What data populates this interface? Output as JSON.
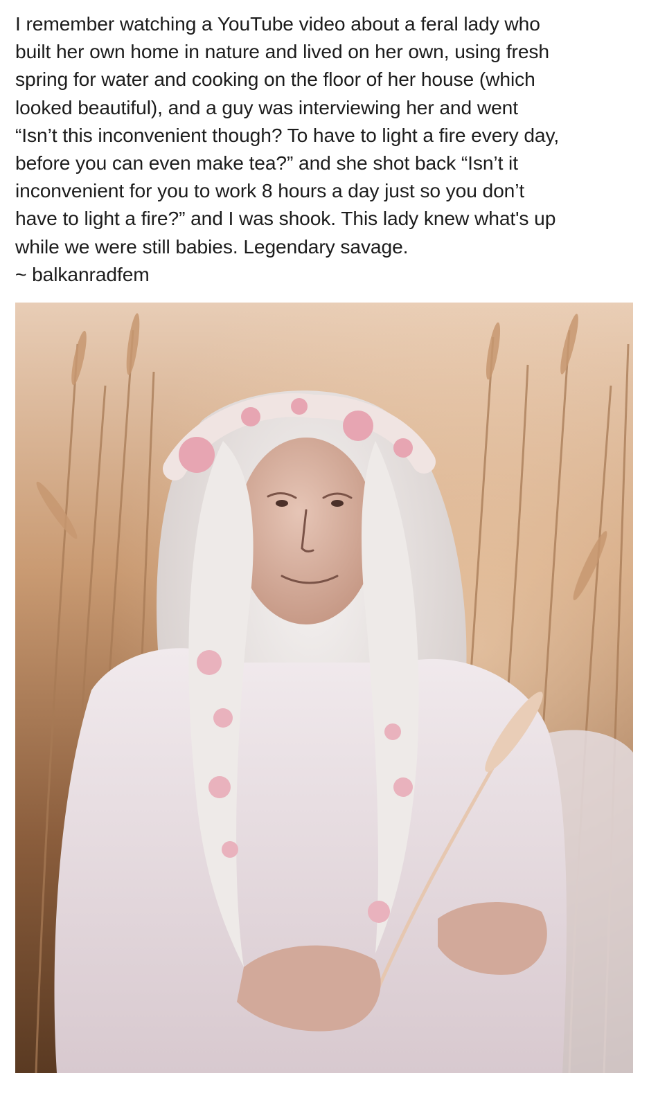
{
  "post": {
    "lines": [
      "I remember watching a YouTube video about a feral lady who",
      "built her own home in nature and lived on her own, using fresh",
      "spring for water and cooking on the floor of her house (which",
      "looked beautiful), and a guy was interviewing her and went",
      "“Isn’t this inconvenient though? To have to light a fire every day,",
      "before you can even make tea?” and she shot back “Isn’t it",
      "inconvenient for you to work 8 hours a day just so you don’t",
      "have to light a fire?” and I was shook. This lady knew what's up",
      "while we were still babies. Legendary savage."
    ],
    "attribution": "~ balkanradfem"
  },
  "photo": {
    "subject": "elderly woman with long white hair and a pink flower crown sitting in a golden wheat field",
    "colors": {
      "field_light": "#d9b592",
      "field_dark": "#5a3a22",
      "hair": "#e9e4e2",
      "dress": "#efe6ea",
      "flowers": "#e7a5b2",
      "skin": "#d9b3a3"
    }
  }
}
